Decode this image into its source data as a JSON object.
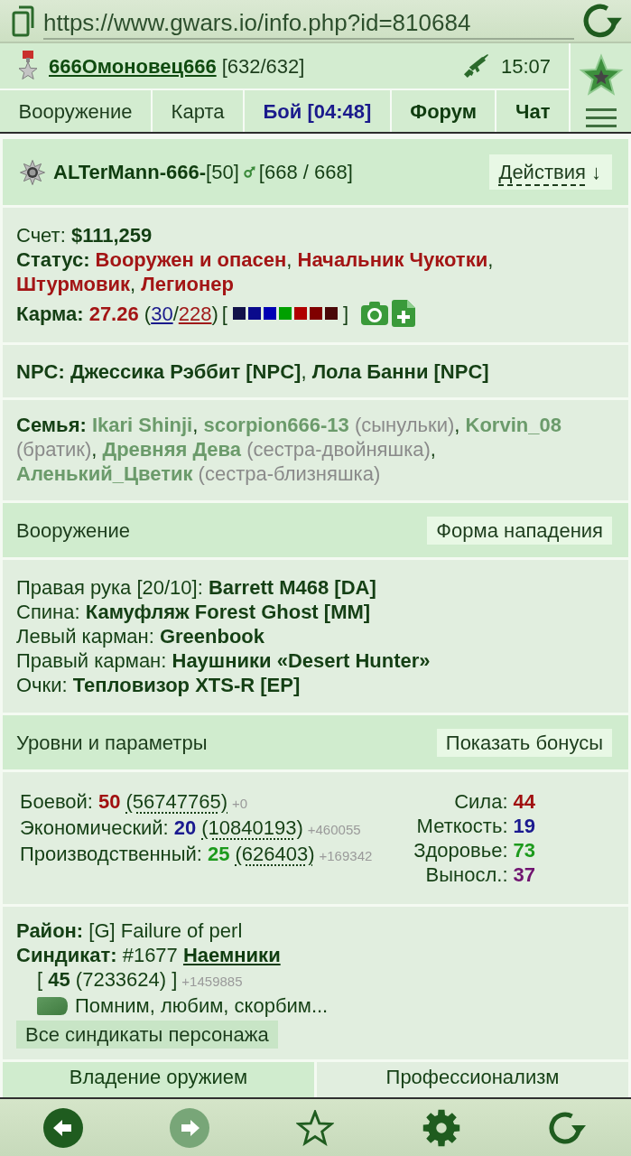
{
  "browser": {
    "url": "https://www.gwars.io/info.php?id=810684"
  },
  "header": {
    "player": "666Омоновец666",
    "hp": "[632/632]",
    "time": "15:07"
  },
  "tabs": [
    {
      "label": "Вооружение",
      "kind": "plain"
    },
    {
      "label": "Карта",
      "kind": "plain"
    },
    {
      "label": "Бой [04:48]",
      "kind": "timer"
    },
    {
      "label": "Форум",
      "kind": "bold"
    },
    {
      "label": "Чат",
      "kind": "bold"
    }
  ],
  "profile": {
    "name": "ALTerMann-666-",
    "level": "[50]",
    "hp": "[668 / 668]",
    "actions": "Действия",
    "actions_arrow": "↓"
  },
  "info": {
    "balance_label": "Счет:",
    "balance": "$111,259",
    "status_label": "Статус:",
    "statuses": [
      "Вооружен и опасен",
      "Начальник Чукотки",
      "Штурмовик",
      "Легионер"
    ],
    "separator": ",",
    "karma": {
      "label": "Карма:",
      "score": "27.26",
      "open": "(",
      "positive": "30",
      "slash": "/",
      "negative": "228",
      "close": ")",
      "marks_open": "[",
      "marks": [
        {
          "color": "#12124a"
        },
        {
          "color": "#0a0a8c"
        },
        {
          "color": "#0000b4"
        },
        {
          "color": "#00a000"
        },
        {
          "color": "#b00000"
        },
        {
          "color": "#800000"
        },
        {
          "color": "#4a0808"
        }
      ],
      "marks_close": "]"
    }
  },
  "npc": {
    "text": "**NPC: Джессика Рэббит [NPC]**, **Лола Банни [NPC]**"
  },
  "family": {
    "label": "Семья:",
    "separator": ",",
    "groups": [
      {
        "names": [
          "Ikari Shinji",
          "scorpion666-13"
        ],
        "relation": "(сынульки)"
      },
      {
        "names": [
          "Korvin_08"
        ],
        "relation": "(братик)"
      },
      {
        "names": [
          "Древняя Дева"
        ],
        "relation": "(сестра-двойняшка)"
      },
      {
        "names": [
          "Аленький_Цветик"
        ],
        "relation": "(сестра-близняшка)"
      }
    ]
  },
  "equipment": {
    "title": "Вооружение",
    "button": "Форма нападения",
    "slots": [
      {
        "slot": "Правая рука [20/10]:",
        "item": "Barrett M468 [DA]"
      },
      {
        "slot": "Спина:",
        "item": "Камуфляж Forest Ghost [MM]"
      },
      {
        "slot": "Левый карман:",
        "item": "Greenbook"
      },
      {
        "slot": "Правый карман:",
        "item": "Наушники «Desert Hunter»"
      },
      {
        "slot": "Очки:",
        "item": "Тепловизор XTS-R [EP]"
      }
    ]
  },
  "levels": {
    "title": "Уровни и параметры",
    "button": "Показать бонусы",
    "skills": [
      {
        "label": "Боевой:",
        "level": "50",
        "exp": "(56747765)",
        "gain": "+0",
        "color": "#a01010"
      },
      {
        "label": "Экономический:",
        "level": "20",
        "exp": "(10840193)",
        "gain": "+460055",
        "color": "#1a1a90"
      },
      {
        "label": "Производственный:",
        "level": "25",
        "exp": "(626403)",
        "gain": "+169342",
        "color": "#1c9a1c"
      }
    ],
    "stats": [
      {
        "label": "Сила:",
        "value": "44",
        "color": "#a01010"
      },
      {
        "label": "Меткость:",
        "value": "19",
        "color": "#1a1a90"
      },
      {
        "label": "Здоровье:",
        "value": "73",
        "color": "#1c9a1c"
      },
      {
        "label": "Выносл.:",
        "value": "37",
        "color": "#701470"
      }
    ]
  },
  "syndicate": {
    "district_label": "Район:",
    "district": "[G] Failure of perl",
    "label": "Синдикат:",
    "number": "#1677",
    "name": "Наемники",
    "level_text": "[ **45** (7233624) ]",
    "gain": "+1459885",
    "motto": "Помним, любим, скорбим...",
    "button": "Все синдикаты персонажа"
  },
  "skill_tabs": [
    {
      "label": "Владение оружием",
      "selected": true
    },
    {
      "label": "Профессионализм",
      "selected": false
    }
  ],
  "nav_buttons": [
    {
      "kind": "back",
      "disabled": false
    },
    {
      "kind": "forward",
      "disabled": true
    },
    {
      "kind": "star",
      "disabled": false
    },
    {
      "kind": "settings",
      "disabled": false
    },
    {
      "kind": "reload",
      "disabled": false
    }
  ]
}
